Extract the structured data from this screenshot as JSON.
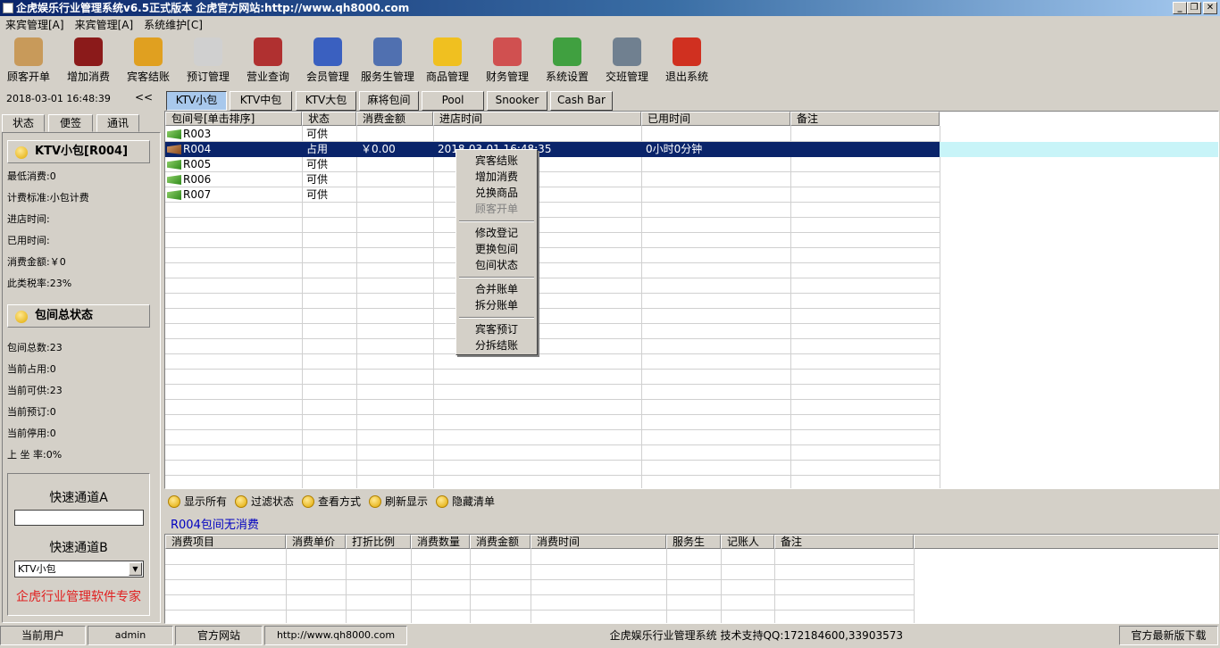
{
  "window": {
    "title": "企虎娱乐行业管理系统v6.5正式版本  企虎官方网站:http://www.qh8000.com",
    "min": "_",
    "max": "❐",
    "close": "✕"
  },
  "menu": [
    "来宾管理[A]",
    "来宾管理[A]",
    "系统维护[C]"
  ],
  "toolbar": [
    {
      "label": "顾客开单",
      "color": "#c89a5a",
      "icon": "key-icon"
    },
    {
      "label": "增加消费",
      "color": "#8b1a1a",
      "icon": "wine-icon"
    },
    {
      "label": "宾客结账",
      "color": "#e0a020",
      "icon": "coins-icon"
    },
    {
      "label": "预订管理",
      "color": "#d0d0d0",
      "icon": "clock-icon"
    },
    {
      "label": "营业查询",
      "color": "#b03030",
      "icon": "document-icon"
    },
    {
      "label": "会员管理",
      "color": "#3a60c0",
      "icon": "member-icon"
    },
    {
      "label": "服务生管理",
      "color": "#5070b0",
      "icon": "staff-icon"
    },
    {
      "label": "商品管理",
      "color": "#f0c020",
      "icon": "star-icon"
    },
    {
      "label": "财务管理",
      "color": "#d05050",
      "icon": "calculator-icon"
    },
    {
      "label": "系统设置",
      "color": "#40a040",
      "icon": "settings-icon"
    },
    {
      "label": "交班管理",
      "color": "#708090",
      "icon": "handshake-icon"
    },
    {
      "label": "退出系统",
      "color": "#d03020",
      "icon": "power-icon"
    }
  ],
  "datetime": "2018-03-01 16:48:39",
  "collapse": "<<",
  "left_tabs": [
    "状态",
    "便签",
    "通讯"
  ],
  "room_panel": {
    "title": "KTV小包[R004]",
    "lines": [
      "最低消费:0",
      "计费标准:小包计费",
      "进店时间:",
      "已用时间:",
      "消费金额:￥0",
      "此类税率:23%"
    ]
  },
  "total_panel": {
    "title": "包间总状态",
    "lines": [
      "包间总数:23",
      "当前占用:0",
      "当前可供:23",
      "当前预订:0",
      "当前停用:0",
      "上 坐 率:0%"
    ]
  },
  "quick": {
    "a_label": "快速通道A",
    "a_value": "",
    "b_label": "快速通道B",
    "b_value": "KTV小包",
    "slogan": "企虎行业管理软件专家"
  },
  "room_tabs": [
    "KTV小包",
    "KTV中包",
    "KTV大包",
    "麻将包间",
    "Pool",
    "Snooker",
    "Cash Bar"
  ],
  "room_grid": {
    "headers": [
      "包间号[单击排序]",
      "状态",
      "消费金额",
      "进店时间",
      "已用时间",
      "备注"
    ],
    "rows": [
      {
        "id": "R003",
        "status": "可供",
        "amount": "",
        "time": "",
        "used": "",
        "note": "",
        "busy": false
      },
      {
        "id": "R004",
        "status": "占用",
        "amount": "￥0.00",
        "time": "2018-03-01 16:48:35",
        "used": "0小时0分钟",
        "note": "",
        "busy": true
      },
      {
        "id": "R005",
        "status": "可供",
        "amount": "",
        "time": "",
        "used": "",
        "note": "",
        "busy": false
      },
      {
        "id": "R006",
        "status": "可供",
        "amount": "",
        "time": "",
        "used": "",
        "note": "",
        "busy": false
      },
      {
        "id": "R007",
        "status": "可供",
        "amount": "",
        "time": "",
        "used": "",
        "note": "",
        "busy": false
      }
    ]
  },
  "context_menu": [
    {
      "label": "宾客结账",
      "disabled": false
    },
    {
      "label": "增加消费",
      "disabled": false
    },
    {
      "label": "兑换商品",
      "disabled": false
    },
    {
      "label": "顾客开单",
      "disabled": true
    },
    {
      "sep": true
    },
    {
      "label": "修改登记",
      "disabled": false
    },
    {
      "label": "更换包间",
      "disabled": false
    },
    {
      "label": "包间状态",
      "disabled": false
    },
    {
      "sep": true
    },
    {
      "label": "合并账单",
      "disabled": false
    },
    {
      "label": "拆分账单",
      "disabled": false
    },
    {
      "sep": true
    },
    {
      "label": "宾客预订",
      "disabled": false
    },
    {
      "label": "分拆结账",
      "disabled": false
    }
  ],
  "bottom_buttons": [
    "显示所有",
    "过滤状态",
    "查看方式",
    "刷新显示",
    "隐藏清单"
  ],
  "consume_note": "R004包间无消费",
  "consume_grid": {
    "headers": [
      "消费项目",
      "消费单价",
      "打折比例",
      "消费数量",
      "消费金额",
      "消费时间",
      "服务生",
      "记账人",
      "备注"
    ]
  },
  "status_bar": {
    "user_label": "当前用户",
    "user": "admin",
    "site_label": "官方网站",
    "site": "http://www.qh8000.com",
    "info": "企虎娱乐行业管理系统  技术支持QQ:172184600,33903573",
    "download": "官方最新版下载"
  }
}
